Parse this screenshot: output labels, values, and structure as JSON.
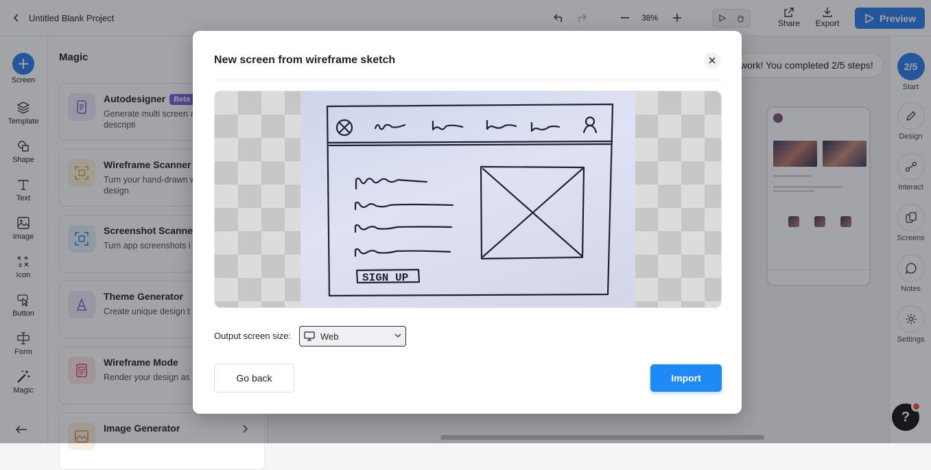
{
  "header": {
    "project_title": "Untitled Blank Project",
    "zoom": "38%",
    "share_label": "Share",
    "export_label": "Export",
    "preview_label": "Preview"
  },
  "left_tools": [
    {
      "label": "Screen",
      "icon": "plus-icon"
    },
    {
      "label": "Template",
      "icon": "layers-icon"
    },
    {
      "label": "Shape",
      "icon": "shape-icon"
    },
    {
      "label": "Text",
      "icon": "text-icon"
    },
    {
      "label": "Image",
      "icon": "image-icon"
    },
    {
      "label": "Icon",
      "icon": "icon-grid-icon"
    },
    {
      "label": "Button",
      "icon": "pointer-icon"
    },
    {
      "label": "Form",
      "icon": "form-icon"
    },
    {
      "label": "Magic",
      "icon": "magic-wand-icon"
    }
  ],
  "magic_panel": {
    "title": "Magic",
    "items": [
      {
        "title": "Autodesigner",
        "badge": "Beta",
        "desc": "Generate multi screen a simple text descripti",
        "color": "#efe9fb",
        "icon_color": "#7b61d6"
      },
      {
        "title": "Wireframe Scanner",
        "desc": "Turn your hand-drawn wireframes into design",
        "color": "#fbf3de",
        "icon_color": "#d9a72a"
      },
      {
        "title": "Screenshot Scanner",
        "desc": "Turn app screenshots i design mockups",
        "color": "#e3f0fb",
        "icon_color": "#2b7de9"
      },
      {
        "title": "Theme Generator",
        "desc": "Create unique design t seconds",
        "color": "#efe9fb",
        "icon_color": "#7b61d6"
      },
      {
        "title": "Wireframe Mode",
        "desc": "Render your design as drawn sketch",
        "color": "#fbe6ec",
        "icon_color": "#d6455e"
      },
      {
        "title": "Image Generator",
        "desc": "",
        "color": "#fbeee1",
        "icon_color": "#e08a3c"
      }
    ]
  },
  "progress": {
    "steps_text": "work! You completed 2/5 steps!",
    "start_badge": "2/5"
  },
  "right_tools": [
    {
      "label": "Start"
    },
    {
      "label": "Design",
      "icon": "pencil-icon"
    },
    {
      "label": "Interact",
      "icon": "link-nodes-icon"
    },
    {
      "label": "Screens",
      "icon": "screens-icon"
    },
    {
      "label": "Notes",
      "icon": "comment-icon"
    },
    {
      "label": "Settings",
      "icon": "gear-icon"
    }
  ],
  "help_label": "?",
  "modal": {
    "title": "New screen from wireframe sketch",
    "output_label": "Output screen size:",
    "select_value": "Web",
    "go_back_label": "Go back",
    "import_label": "Import",
    "sketch_button_text": "SIGN UP"
  },
  "colors": {
    "accent": "#2b7de9",
    "import": "#1f8af5"
  }
}
